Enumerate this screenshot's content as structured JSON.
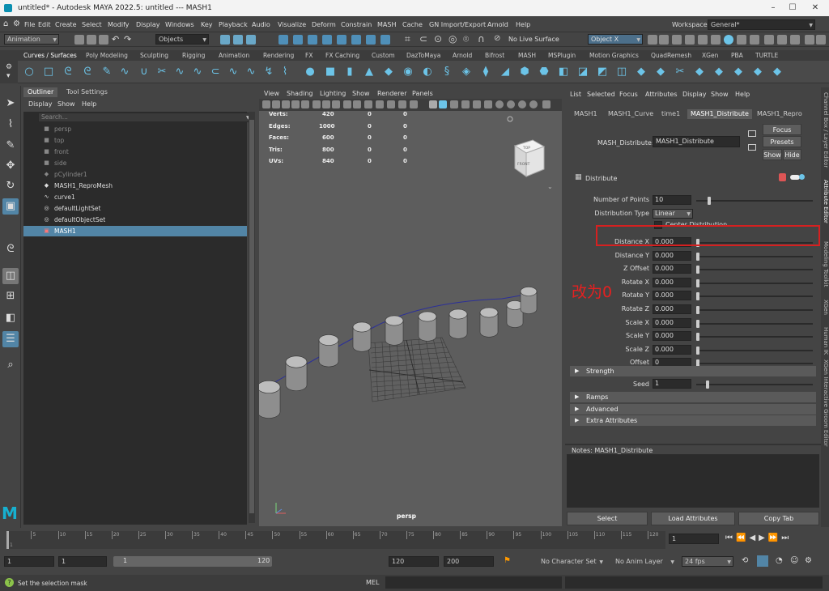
{
  "window": {
    "title": "untitled* - Autodesk MAYA 2022.5: untitled  ---  MASH1"
  },
  "menubar": {
    "menuset": "Animation",
    "items": [
      "File",
      "Edit",
      "Create",
      "Select",
      "Modify",
      "Display",
      "Windows",
      "Key",
      "Playback",
      "Audio",
      "Visualize",
      "Deform",
      "Constrain",
      "MASH",
      "Cache",
      "GN Import/Export",
      "Arnold",
      "Help"
    ],
    "workspace_label": "Workspace:",
    "workspace_value": "General*"
  },
  "statusline": {
    "select_mode": "Objects",
    "live_surface": "No Live Surface",
    "name_field": "Object X"
  },
  "shelf": {
    "tabs": [
      "Curves / Surfaces",
      "Poly Modeling",
      "Sculpting",
      "Rigging",
      "Animation",
      "Rendering",
      "FX",
      "FX Caching",
      "Custom",
      "DazToMaya",
      "Arnold",
      "Bifrost",
      "MASH",
      "MSPlugin",
      "Motion Graphics",
      "QuadRemesh",
      "XGen",
      "PBA",
      "TURTLE"
    ],
    "active": "Curves / Surfaces"
  },
  "outliner": {
    "tabs": [
      "Outliner",
      "Tool Settings"
    ],
    "menu": [
      "Display",
      "Show",
      "Help"
    ],
    "search_placeholder": "Search...",
    "items": [
      {
        "label": "persp",
        "dim": true,
        "icon": "camera-icon"
      },
      {
        "label": "top",
        "dim": true,
        "icon": "camera-icon"
      },
      {
        "label": "front",
        "dim": true,
        "icon": "camera-icon"
      },
      {
        "label": "side",
        "dim": true,
        "icon": "camera-icon"
      },
      {
        "label": "pCylinder1",
        "dim": true,
        "icon": "mesh-icon"
      },
      {
        "label": "MASH1_ReproMesh",
        "dim": false,
        "icon": "mesh-icon"
      },
      {
        "label": "curve1",
        "dim": false,
        "icon": "curve-icon"
      },
      {
        "label": "defaultLightSet",
        "dim": false,
        "icon": "set-icon"
      },
      {
        "label": "defaultObjectSet",
        "dim": false,
        "icon": "set-icon"
      },
      {
        "label": "MASH1",
        "dim": false,
        "icon": "mash-icon",
        "selected": true
      }
    ]
  },
  "viewport": {
    "menu": [
      "View",
      "Shading",
      "Lighting",
      "Show",
      "Renderer",
      "Panels"
    ],
    "hud": [
      {
        "label": "Verts:",
        "a": "420",
        "b": "0",
        "c": "0"
      },
      {
        "label": "Edges:",
        "a": "1000",
        "b": "0",
        "c": "0"
      },
      {
        "label": "Faces:",
        "a": "600",
        "b": "0",
        "c": "0"
      },
      {
        "label": "Tris:",
        "a": "800",
        "b": "0",
        "c": "0"
      },
      {
        "label": "UVs:",
        "a": "840",
        "b": "0",
        "c": "0"
      }
    ],
    "camera_label": "persp",
    "viewcube_top": "TOP",
    "viewcube_front": "FRONT"
  },
  "attribute_editor": {
    "menu": [
      "List",
      "Selected",
      "Focus",
      "Attributes",
      "Display",
      "Show",
      "Help"
    ],
    "tabs": [
      "MASH1",
      "MASH1_Curve",
      "time1",
      "MASH1_Distribute",
      "MASH1_Repro"
    ],
    "active_tab": "MASH1_Distribute",
    "node_label": "MASH_Distribute:",
    "node_name": "MASH1_Distribute",
    "buttons": {
      "focus": "Focus",
      "presets": "Presets",
      "show": "Show",
      "hide": "Hide"
    },
    "section_title": "Distribute",
    "attrs": [
      {
        "label": "Number of Points",
        "value": "10",
        "knob": 0.1
      },
      {
        "label": "Distribution Type",
        "value": "Linear",
        "dropdown": true
      },
      {
        "label": "Center Distribution",
        "checkbox": true
      },
      {
        "label": "Distance X",
        "value": "0.000",
        "knob": 0.0
      },
      {
        "label": "Distance Y",
        "value": "0.000",
        "knob": 0.0
      },
      {
        "label": "Z Offset",
        "value": "0.000",
        "knob": 0.0
      },
      {
        "label": "Rotate X",
        "value": "0.000",
        "knob": 0.0
      },
      {
        "label": "Rotate Y",
        "value": "0.000",
        "knob": 0.0
      },
      {
        "label": "Rotate Z",
        "value": "0.000",
        "knob": 0.0
      },
      {
        "label": "Scale X",
        "value": "0.000",
        "knob": 0.0
      },
      {
        "label": "Scale Y",
        "value": "0.000",
        "knob": 0.0
      },
      {
        "label": "Scale Z",
        "value": "0.000",
        "knob": 0.0
      },
      {
        "label": "Offset",
        "value": "0",
        "knob": 0.0
      }
    ],
    "strength_frame": "Strength",
    "seed_label": "Seed",
    "seed_value": "1",
    "frames": [
      "Ramps",
      "Advanced",
      "Extra Attributes"
    ],
    "notes_label": "Notes:  MASH1_Distribute",
    "bottom_buttons": [
      "Select",
      "Load Attributes",
      "Copy Tab"
    ],
    "annotation": "改为0"
  },
  "side_tabs": [
    "Channel Box / Layer Editor",
    "Attribute Editor",
    "Modeling Toolkit",
    "XGen",
    "Human IK",
    "XGen Interactive Groom Editor"
  ],
  "timeline": {
    "ticks": [
      "5",
      "10",
      "15",
      "20",
      "25",
      "30",
      "35",
      "40",
      "45",
      "50",
      "55",
      "60",
      "65",
      "70",
      "75",
      "80",
      "85",
      "90",
      "95",
      "100",
      "105",
      "110",
      "115",
      "120"
    ],
    "first_tick": "1",
    "current_frame": "1"
  },
  "range": {
    "start": "1",
    "playback_start": "1",
    "slider_start": "1",
    "slider_end": "120",
    "playback_end": "120",
    "end": "200",
    "character_set": "No Character Set",
    "anim_layer": "No Anim Layer",
    "fps": "24 fps"
  },
  "helpline": {
    "text": "Set the selection mask",
    "mel_label": "MEL"
  },
  "colors": {
    "selection": "#5285a6",
    "annotation": "#e62020",
    "accent": "#6cc4e8"
  }
}
